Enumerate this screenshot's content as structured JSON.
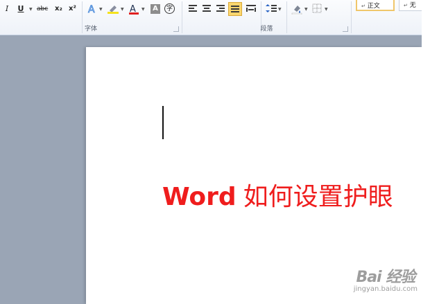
{
  "ribbon": {
    "font_group": {
      "label": "字体",
      "italic": "I",
      "underline": "U",
      "strikethrough": "abc",
      "subscript": "x₂",
      "superscript": "x²",
      "font_color_glyph": "A",
      "char_shading_glyph": "A",
      "enclose_char_glyph": "字"
    },
    "paragraph_group": {
      "label": "段落"
    },
    "styles_group": {
      "normal_style": "正文",
      "next_style_partial": "无"
    }
  },
  "document": {
    "title_latin": "Word",
    "title_cjk": "如何设置护眼"
  },
  "watermark": {
    "main": "Bai 经验",
    "sub": "jingyan.baidu.com"
  },
  "colors": {
    "title_red": "#ef1d1d",
    "workspace_gray": "#9aa5b5",
    "highlight_yellow": "#f5e21c",
    "selected_gold": "#f0c66a"
  }
}
